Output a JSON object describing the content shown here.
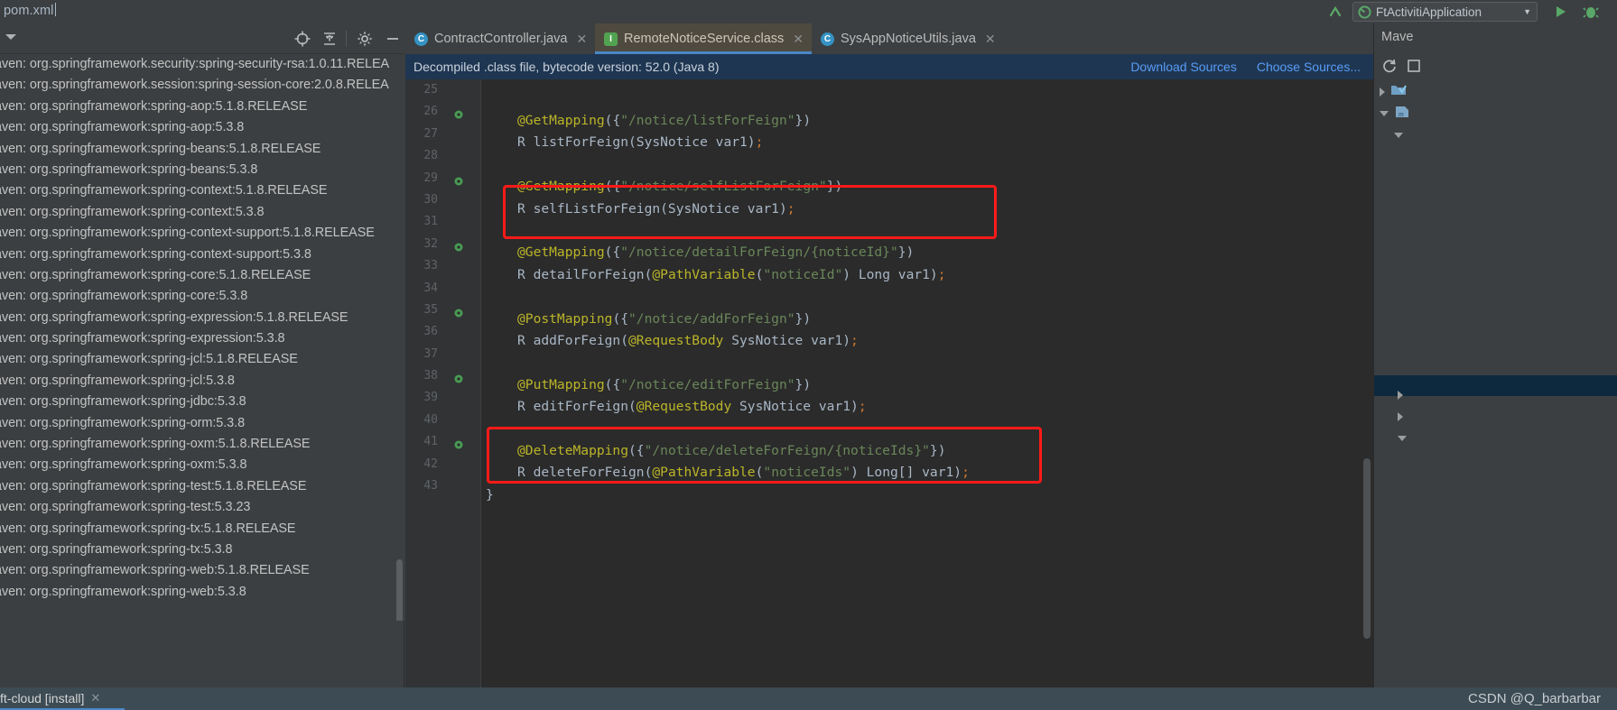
{
  "window": {
    "breadcrumb": "pom.xml"
  },
  "toolbar": {
    "run_config_label": "FtActivitiApplication",
    "icons": [
      {
        "name": "back-arrow-icon",
        "glyph": "↰"
      },
      {
        "name": "run-icon",
        "glyph": "▶"
      },
      {
        "name": "debug-icon",
        "glyph": "🐞"
      }
    ]
  },
  "left_panel": {
    "title": "",
    "toolbar_icons": [
      {
        "name": "collapse-all-icon"
      },
      {
        "name": "locate-icon"
      },
      {
        "name": "expand-collapse-icon"
      },
      {
        "name": "settings-gear-icon"
      },
      {
        "name": "hide-icon"
      }
    ],
    "dependencies": [
      "aven: org.springframework.security:spring-security-rsa:1.0.11.RELEA",
      "aven: org.springframework.session:spring-session-core:2.0.8.RELEA",
      "aven: org.springframework:spring-aop:5.1.8.RELEASE",
      "aven: org.springframework:spring-aop:5.3.8",
      "aven: org.springframework:spring-beans:5.1.8.RELEASE",
      "aven: org.springframework:spring-beans:5.3.8",
      "aven: org.springframework:spring-context:5.1.8.RELEASE",
      "aven: org.springframework:spring-context:5.3.8",
      "aven: org.springframework:spring-context-support:5.1.8.RELEASE",
      "aven: org.springframework:spring-context-support:5.3.8",
      "aven: org.springframework:spring-core:5.1.8.RELEASE",
      "aven: org.springframework:spring-core:5.3.8",
      "aven: org.springframework:spring-expression:5.1.8.RELEASE",
      "aven: org.springframework:spring-expression:5.3.8",
      "aven: org.springframework:spring-jcl:5.1.8.RELEASE",
      "aven: org.springframework:spring-jcl:5.3.8",
      "aven: org.springframework:spring-jdbc:5.3.8",
      "aven: org.springframework:spring-orm:5.3.8",
      "aven: org.springframework:spring-oxm:5.1.8.RELEASE",
      "aven: org.springframework:spring-oxm:5.3.8",
      "aven: org.springframework:spring-test:5.1.8.RELEASE",
      "aven: org.springframework:spring-test:5.3.23",
      "aven: org.springframework:spring-tx:5.1.8.RELEASE",
      "aven: org.springframework:spring-tx:5.3.8",
      "aven: org.springframework:spring-web:5.1.8.RELEASE",
      "aven: org.springframework:spring-web:5.3.8"
    ]
  },
  "editor": {
    "tabs": [
      {
        "label": "ContractController.java",
        "icon": "class-icon",
        "icon_letter": "C",
        "icon_kind": "c",
        "active": false,
        "close": "✕"
      },
      {
        "label": "RemoteNoticeService.class",
        "icon": "interface-icon",
        "icon_letter": "I",
        "icon_kind": "i",
        "active": true,
        "close": "✕"
      },
      {
        "label": "SysAppNoticeUtils.java",
        "icon": "class-icon",
        "icon_letter": "C",
        "icon_kind": "c",
        "active": false,
        "close": "✕"
      }
    ],
    "notice": {
      "message": "Decompiled .class file, bytecode version: 52.0 (Java 8)",
      "action_download": "Download Sources",
      "action_choose": "Choose Sources..."
    },
    "gutter": {
      "line_numbers": [
        "25",
        "26",
        "27",
        "28",
        "29",
        "30",
        "31",
        "32",
        "33",
        "34",
        "35",
        "36",
        "37",
        "38",
        "39",
        "40",
        "41",
        "42",
        "43"
      ],
      "impl_marker_lines": [
        "26",
        "29",
        "32",
        "35",
        "38",
        "41"
      ]
    },
    "code_lines": [
      {
        "n": "25",
        "indent": "normal",
        "segments": [
          {
            "t": "@GetMapping",
            "c": "anno"
          },
          {
            "t": "({",
            "c": "plain"
          },
          {
            "t": "\"/notice/listForFeign\"",
            "c": "str"
          },
          {
            "t": "})",
            "c": "plain"
          }
        ]
      },
      {
        "n": "26",
        "indent": "normal",
        "segments": [
          {
            "t": "R listForFeign(SysNotice var1)",
            "c": "plain"
          },
          {
            "t": ";",
            "c": "semi"
          }
        ]
      },
      {
        "n": "27",
        "indent": "normal",
        "segments": []
      },
      {
        "n": "28",
        "indent": "normal",
        "segments": [
          {
            "t": "@GetMapping",
            "c": "anno"
          },
          {
            "t": "({",
            "c": "plain"
          },
          {
            "t": "\"/notice/selfListForFeign\"",
            "c": "str"
          },
          {
            "t": "})",
            "c": "plain"
          }
        ]
      },
      {
        "n": "29",
        "indent": "normal",
        "segments": [
          {
            "t": "R selfListForFeign(SysNotice var1)",
            "c": "plain"
          },
          {
            "t": ";",
            "c": "semi"
          }
        ]
      },
      {
        "n": "30",
        "indent": "normal",
        "segments": []
      },
      {
        "n": "31",
        "indent": "normal",
        "segments": [
          {
            "t": "@GetMapping",
            "c": "anno"
          },
          {
            "t": "({",
            "c": "plain"
          },
          {
            "t": "\"/notice/detailForFeign/{noticeId}\"",
            "c": "str"
          },
          {
            "t": "})",
            "c": "plain"
          }
        ]
      },
      {
        "n": "32",
        "indent": "normal",
        "segments": [
          {
            "t": "R detailForFeign(",
            "c": "plain"
          },
          {
            "t": "@PathVariable",
            "c": "anno"
          },
          {
            "t": "(",
            "c": "plain"
          },
          {
            "t": "\"noticeId\"",
            "c": "str"
          },
          {
            "t": ") Long var1)",
            "c": "plain"
          },
          {
            "t": ";",
            "c": "semi"
          }
        ]
      },
      {
        "n": "33",
        "indent": "normal",
        "segments": []
      },
      {
        "n": "34",
        "indent": "normal",
        "segments": [
          {
            "t": "@PostMapping",
            "c": "anno"
          },
          {
            "t": "({",
            "c": "plain"
          },
          {
            "t": "\"/notice/addForFeign\"",
            "c": "str"
          },
          {
            "t": "})",
            "c": "plain"
          }
        ]
      },
      {
        "n": "35",
        "indent": "normal",
        "segments": [
          {
            "t": "R addForFeign(",
            "c": "plain"
          },
          {
            "t": "@RequestBody",
            "c": "anno"
          },
          {
            "t": " SysNotice var1)",
            "c": "plain"
          },
          {
            "t": ";",
            "c": "semi"
          }
        ]
      },
      {
        "n": "36",
        "indent": "normal",
        "segments": []
      },
      {
        "n": "37",
        "indent": "normal",
        "segments": [
          {
            "t": "@PutMapping",
            "c": "anno"
          },
          {
            "t": "({",
            "c": "plain"
          },
          {
            "t": "\"/notice/editForFeign\"",
            "c": "str"
          },
          {
            "t": "})",
            "c": "plain"
          }
        ]
      },
      {
        "n": "38",
        "indent": "normal",
        "segments": [
          {
            "t": "R editForFeign(",
            "c": "plain"
          },
          {
            "t": "@RequestBody",
            "c": "anno"
          },
          {
            "t": " SysNotice var1)",
            "c": "plain"
          },
          {
            "t": ";",
            "c": "semi"
          }
        ]
      },
      {
        "n": "39",
        "indent": "normal",
        "segments": []
      },
      {
        "n": "40",
        "indent": "normal",
        "segments": [
          {
            "t": "@DeleteMapping",
            "c": "anno"
          },
          {
            "t": "({",
            "c": "plain"
          },
          {
            "t": "\"/notice/deleteForFeign/{noticeIds}\"",
            "c": "str"
          },
          {
            "t": "})",
            "c": "plain"
          }
        ]
      },
      {
        "n": "41",
        "indent": "normal",
        "segments": [
          {
            "t": "R deleteForFeign(",
            "c": "plain"
          },
          {
            "t": "@PathVariable",
            "c": "anno"
          },
          {
            "t": "(",
            "c": "plain"
          },
          {
            "t": "\"noticeIds\"",
            "c": "str"
          },
          {
            "t": ") Long[] var1)",
            "c": "plain"
          },
          {
            "t": ";",
            "c": "semi"
          }
        ]
      },
      {
        "n": "42",
        "indent": "brace",
        "segments": [
          {
            "t": "}",
            "c": "plain"
          }
        ]
      },
      {
        "n": "43",
        "indent": "normal",
        "segments": []
      }
    ],
    "highlights": [
      {
        "name": "detail-for-feign-highlight",
        "color": "#ff1a18"
      },
      {
        "name": "delete-for-feign-highlight",
        "color": "#ff1a18"
      }
    ]
  },
  "right_panel": {
    "title": "Mave",
    "icons": [
      {
        "name": "refresh-icon"
      },
      {
        "name": "add-icon"
      }
    ]
  },
  "status_bar": {
    "task": "ft-cloud [install]",
    "close": "✕",
    "watermark": "CSDN @Q_barbarbar"
  },
  "colors": {
    "accent_blue": "#4a88c7",
    "highlight_red": "#ff1a18",
    "notice_bg": "#1f3652",
    "editor_bg": "#2b2b2b",
    "panel_bg": "#3c3f41",
    "status_bg": "#3c4b54",
    "string_green": "#6a8759",
    "annotation_yellow": "#bbb529"
  }
}
